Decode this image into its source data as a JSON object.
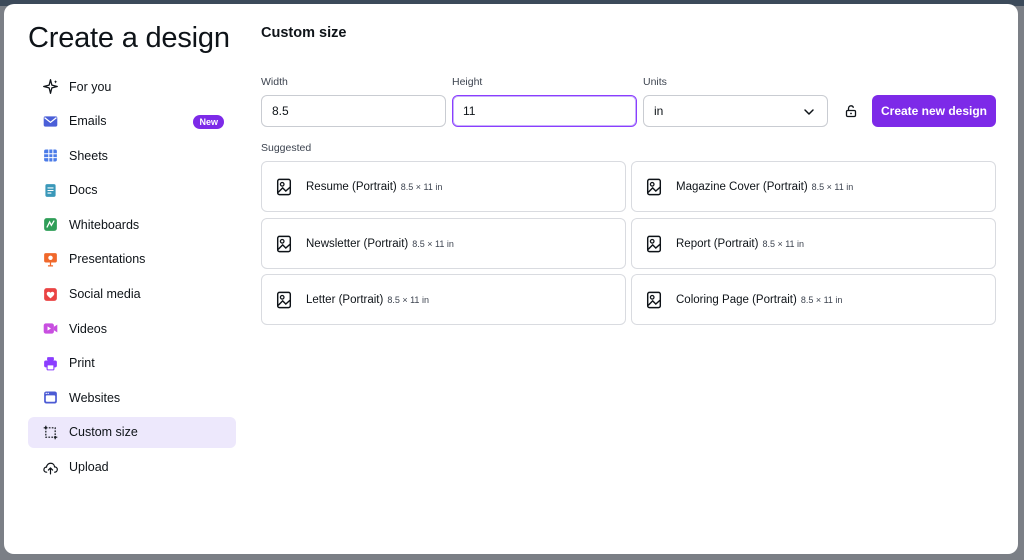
{
  "sidebar": {
    "title": "Create a design",
    "items": [
      {
        "label": "For you",
        "icon": "sparkles-icon",
        "color": "#0e1318"
      },
      {
        "label": "Emails",
        "icon": "envelope-icon",
        "color": "#4a5fd8",
        "badge": "New"
      },
      {
        "label": "Sheets",
        "icon": "sheets-icon",
        "color": "#4b7be8"
      },
      {
        "label": "Docs",
        "icon": "docs-icon",
        "color": "#3a98b9"
      },
      {
        "label": "Whiteboards",
        "icon": "whiteboard-icon",
        "color": "#2f9e58"
      },
      {
        "label": "Presentations",
        "icon": "presentation-icon",
        "color": "#f0682b"
      },
      {
        "label": "Social media",
        "icon": "heart-icon",
        "color": "#ea4444"
      },
      {
        "label": "Videos",
        "icon": "video-icon",
        "color": "#c84fe0"
      },
      {
        "label": "Print",
        "icon": "printer-icon",
        "color": "#8b3dff"
      },
      {
        "label": "Websites",
        "icon": "website-icon",
        "color": "#4c5bd4"
      },
      {
        "label": "Custom size",
        "icon": "custom-size-icon",
        "color": "#0e1318",
        "active": true
      },
      {
        "label": "Upload",
        "icon": "cloud-upload-icon",
        "color": "#0e1318"
      }
    ]
  },
  "main": {
    "title": "Custom size",
    "width_label": "Width",
    "width_value": "8.5",
    "height_label": "Height",
    "height_value": "11",
    "units_label": "Units",
    "units_value": "in",
    "create_label": "Create new design",
    "suggested_label": "Suggested",
    "suggestions": [
      {
        "name": "Resume (Portrait)",
        "dims": "8.5 × 11 in"
      },
      {
        "name": "Magazine Cover (Portrait)",
        "dims": "8.5 × 11 in"
      },
      {
        "name": "Newsletter (Portrait)",
        "dims": "8.5 × 11 in"
      },
      {
        "name": "Report (Portrait)",
        "dims": "8.5 × 11 in"
      },
      {
        "name": "Letter (Portrait)",
        "dims": "8.5 × 11 in"
      },
      {
        "name": "Coloring Page (Portrait)",
        "dims": "8.5 × 11 in"
      }
    ]
  },
  "colors": {
    "accent": "#7d2ae8",
    "active_bg": "#ede8fc",
    "focus_border": "#8b3dff"
  }
}
